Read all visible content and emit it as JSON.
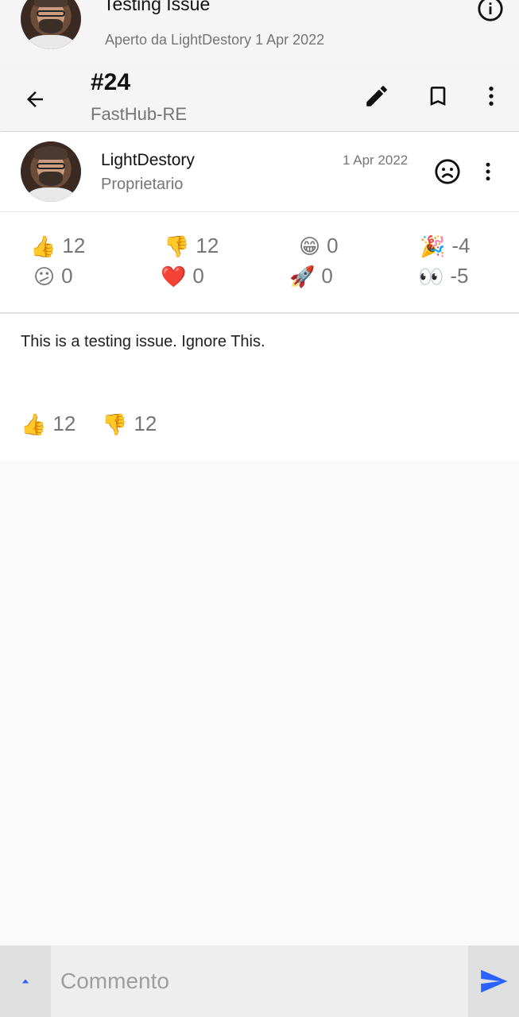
{
  "issue_header": {
    "title": "Testing Issue",
    "subtitle": "Aperto da LightDestory 1 Apr 2022"
  },
  "toolbar": {
    "number": "#24",
    "repo": "FastHub-RE"
  },
  "comment": {
    "author": "LightDestory",
    "role": "Proprietario",
    "date": "1 Apr 2022",
    "body": "This is a testing issue. Ignore This.",
    "reactions": [
      {
        "emoji": "👍",
        "name": "thumbs-up",
        "count": "12"
      },
      {
        "emoji": "👎",
        "name": "thumbs-down",
        "count": "12"
      },
      {
        "emoji": "😁",
        "name": "laugh",
        "count": "0"
      },
      {
        "emoji": "🎉",
        "name": "hooray",
        "count": "-4"
      },
      {
        "emoji": "😕",
        "name": "confused",
        "count": "0"
      },
      {
        "emoji": "❤️",
        "name": "heart",
        "count": "0"
      },
      {
        "emoji": "🚀",
        "name": "rocket",
        "count": "0"
      },
      {
        "emoji": "👀",
        "name": "eyes",
        "count": "-5"
      }
    ],
    "summary_reactions": [
      {
        "emoji": "👍",
        "name": "thumbs-up",
        "count": "12"
      },
      {
        "emoji": "👎",
        "name": "thumbs-down",
        "count": "12"
      }
    ]
  },
  "composer": {
    "placeholder": "Commento"
  },
  "colors": {
    "accent": "#2962ff",
    "header_bg": "#f5f5f5",
    "secondary_text": "#757575"
  }
}
